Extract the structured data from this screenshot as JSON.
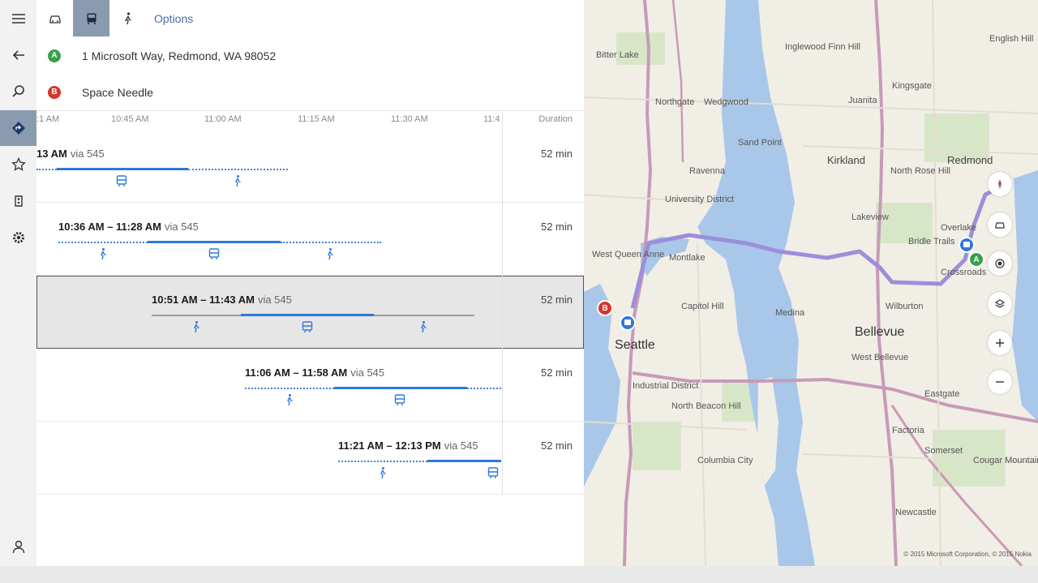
{
  "modes": {
    "options_label": "Options",
    "items": [
      {
        "icon": "car-icon",
        "active": false
      },
      {
        "icon": "bus-icon",
        "active": true
      },
      {
        "icon": "walk-icon",
        "active": false
      }
    ]
  },
  "waypoints": {
    "a": {
      "marker": "A",
      "text": "1 Microsoft Way, Redmond, WA 98052",
      "color": "#3aa04a"
    },
    "b": {
      "marker": "B",
      "text": "Space Needle",
      "color": "#d9342b"
    }
  },
  "timeline": {
    "ticks": [
      ":1 AM",
      "10:45 AM",
      "11:00 AM",
      "11:15 AM",
      "11:30 AM",
      "11:4"
    ],
    "duration_header": "Duration"
  },
  "routes": [
    {
      "time": "13 AM",
      "via": "via 545",
      "duration": "52 min",
      "selected": false
    },
    {
      "time": "10:36 AM – 11:28 AM",
      "via": "via 545",
      "duration": "52 min",
      "selected": false
    },
    {
      "time": "10:51 AM – 11:43 AM",
      "via": "via 545",
      "duration": "52 min",
      "selected": true
    },
    {
      "time": "11:06 AM – 11:58 AM",
      "via": "via 545",
      "duration": "52 min",
      "selected": false
    },
    {
      "time": "11:21 AM – 12:13 PM",
      "via": "via 545",
      "duration": "52 min",
      "selected": false
    }
  ],
  "map": {
    "labels": {
      "seattle": "Seattle",
      "bellevue": "Bellevue",
      "kirkland": "Kirkland",
      "redmond": "Redmond",
      "bitter_lake": "Bitter Lake",
      "northgate": "Northgate",
      "wedgwood": "Wedgwood",
      "university_district": "University District",
      "queen_anne": "West Queen Anne",
      "capitol_hill": "Capitol Hill",
      "montlake": "Montlake",
      "medina": "Medina",
      "west_bellevue": "West Bellevue",
      "industrial": "Industrial District",
      "beacon_hill": "North Beacon Hill",
      "columbia_city": "Columbia City",
      "somerset": "Somerset",
      "factoria": "Factoria",
      "newcastle": "Newcastle",
      "cougar_mountain": "Cougar Mountain",
      "bridle_trails": "Bridle Trails",
      "inglewood": "Inglewood Finn Hill",
      "juanita": "Juanita",
      "sand_point": "Sand Point",
      "ravenna": "Ravenna",
      "wilburton": "Wilburton",
      "crossroads": "Crossroads",
      "eastgate": "Eastgate",
      "english_hill": "English Hill",
      "north_rose_hill": "North Rose Hill",
      "lakeview": "Lakeview",
      "kingsgate": "Kingsgate",
      "overlake": "Overlake"
    },
    "copyright": "© 2015 Microsoft Corporation, © 2015 Nokia",
    "route_color": "#9b8fdc",
    "water_color": "#a9c7e8"
  }
}
